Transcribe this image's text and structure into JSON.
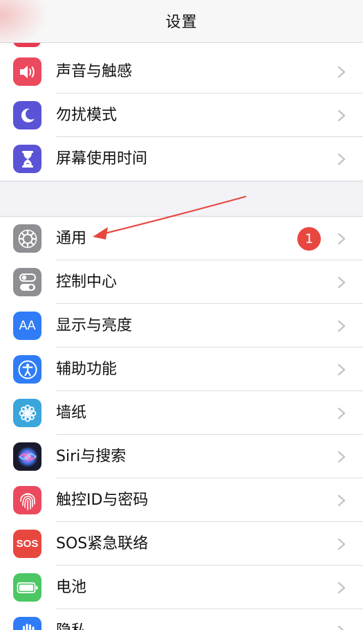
{
  "nav": {
    "title": "设置"
  },
  "groups": {
    "top": [
      {
        "label": "声音与触感",
        "icon": "speaker-icon",
        "color": "#eb4a5e"
      },
      {
        "label": "勿扰模式",
        "icon": "moon-icon",
        "color": "#5a53d6"
      },
      {
        "label": "屏幕使用时间",
        "icon": "hourglass-icon",
        "color": "#5a53d6"
      }
    ],
    "main": [
      {
        "label": "通用",
        "icon": "gear-icon",
        "color": "#8e8e93",
        "badge": "1"
      },
      {
        "label": "控制中心",
        "icon": "toggles-icon",
        "color": "#8e8e93"
      },
      {
        "label": "显示与亮度",
        "icon": "text-size-icon",
        "color": "#2f7cf6",
        "icon_text": "AA"
      },
      {
        "label": "辅助功能",
        "icon": "accessibility-icon",
        "color": "#2f7cf6"
      },
      {
        "label": "墙纸",
        "icon": "flower-icon",
        "color": "#3aa6dc"
      },
      {
        "label": "Siri与搜索",
        "icon": "siri-icon",
        "color": "#1a1a2e"
      },
      {
        "label": "触控ID与密码",
        "icon": "fingerprint-icon",
        "color": "#eb4a5e"
      },
      {
        "label": "SOS紧急联络",
        "icon": "sos-icon",
        "color": "#e8473f",
        "icon_text": "SOS"
      },
      {
        "label": "电池",
        "icon": "battery-icon",
        "color": "#4cc764"
      },
      {
        "label": "隐私",
        "icon": "hand-icon",
        "color": "#2f7cf6"
      }
    ]
  },
  "annotation": {
    "arrow_color": "#e8473f"
  }
}
